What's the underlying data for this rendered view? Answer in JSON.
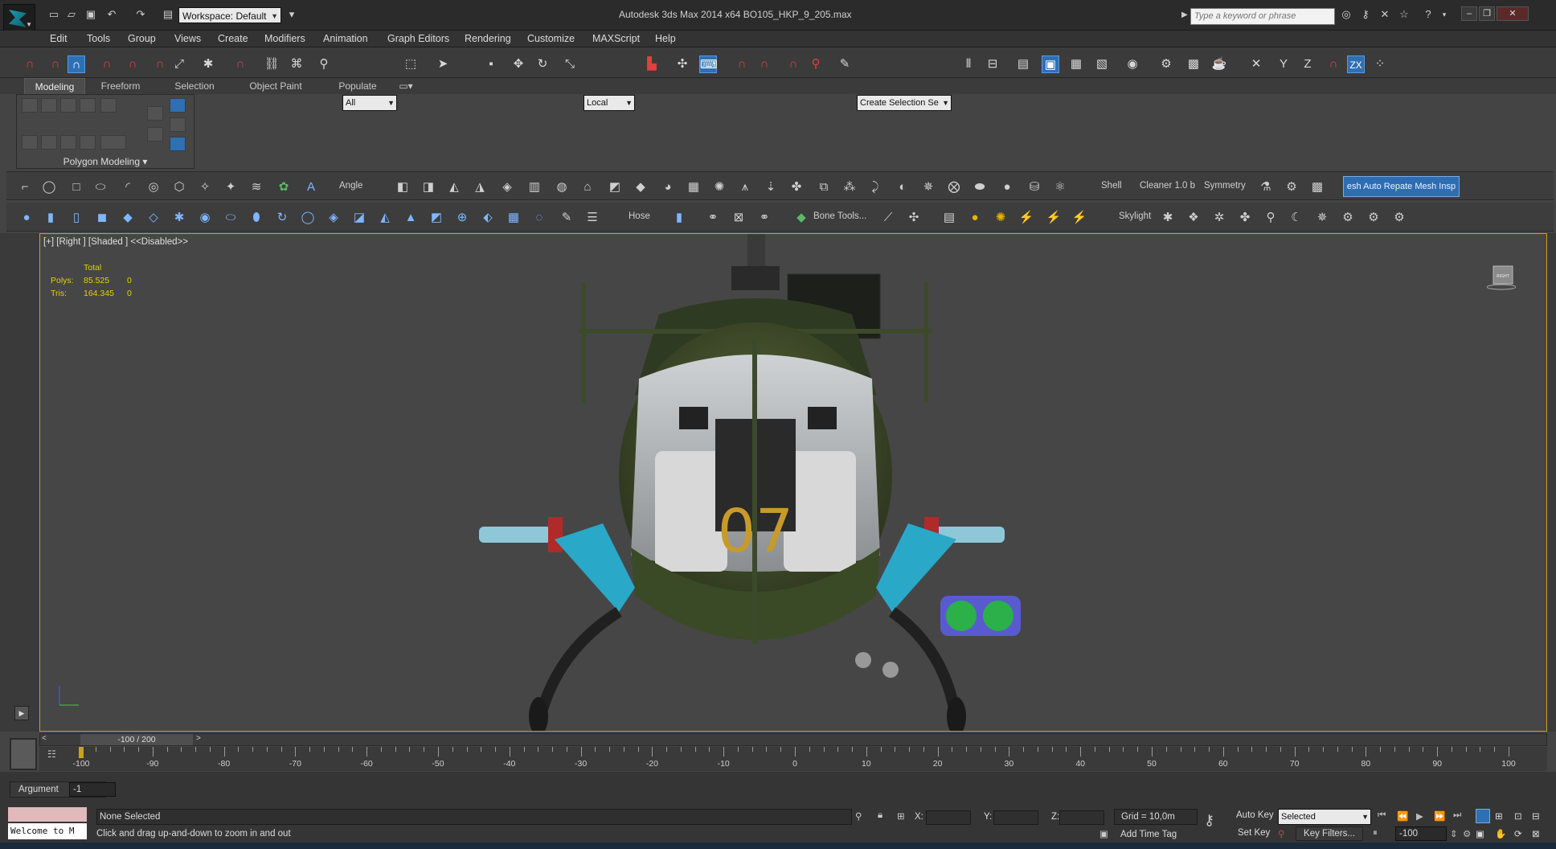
{
  "titlebar": {
    "workspace": "Workspace: Default",
    "title": "Autodesk 3ds Max  2014 x64      BO105_HKP_9_205.max",
    "search_placeholder": "Type a keyword or phrase"
  },
  "menu": [
    "Edit",
    "Tools",
    "Group",
    "Views",
    "Create",
    "Modifiers",
    "Animation",
    "Graph Editors",
    "Rendering",
    "Customize",
    "MAXScript",
    "Help"
  ],
  "main_toolbar": {
    "selection_filter": "All",
    "ref_coord": "Local",
    "named_selection": "Create Selection Se"
  },
  "ribbon": {
    "tabs": [
      "Modeling",
      "Freeform",
      "Selection",
      "Object Paint",
      "Populate"
    ],
    "active_tab": "Modeling",
    "panel_label": "Polygon Modeling"
  },
  "toolbar2": {
    "angle_label": "Angle",
    "shell_label": "Shell",
    "cleaner_label": "Cleaner 1.0 b",
    "symmetry_label": "Symmetry",
    "mesh_button": "esh Auto Repate Mesh Insp"
  },
  "toolbar3": {
    "hose_label": "Hose",
    "bone_tools_label": "Bone Tools...",
    "skylight_label": "Skylight"
  },
  "viewport": {
    "label": "[+] [Right ] [Shaded ] <<Disabled>>",
    "stats": {
      "header": "Total",
      "polys_label": "Polys:",
      "polys_total": "85.525",
      "polys_sel": "0",
      "tris_label": "Tris:",
      "tris_total": "164.345",
      "tris_sel": "0"
    },
    "fuselage_number": "07",
    "viewcube_label": "RIGHT"
  },
  "timeline": {
    "slider_text": "-100 / 200",
    "ruler_labels": [
      "-100",
      "-90",
      "-80",
      "-70",
      "-60",
      "-50",
      "-40",
      "-30",
      "-20",
      "-10",
      "0",
      "10",
      "20",
      "30",
      "40",
      "50",
      "60",
      "70",
      "80",
      "90",
      "100"
    ]
  },
  "status": {
    "argument_label": "Argument",
    "argument_value": "-1",
    "listener_text": "Welcome to M",
    "selection_status": "None Selected",
    "prompt": "Click and drag up-and-down to zoom in and out",
    "x_label": "X:",
    "y_label": "Y:",
    "z_label": "Z:",
    "grid": "Grid = 10,0m",
    "add_time_tag": "Add Time Tag",
    "auto_key": "Auto Key",
    "auto_key_mode": "Selected",
    "set_key": "Set Key",
    "key_filters": "Key Filters...",
    "frame_value": "-100"
  },
  "colors": {
    "accent_blue": "#2f6fb3",
    "viewport_border": "#c9a21a",
    "stats_yellow": "#e6d100"
  }
}
